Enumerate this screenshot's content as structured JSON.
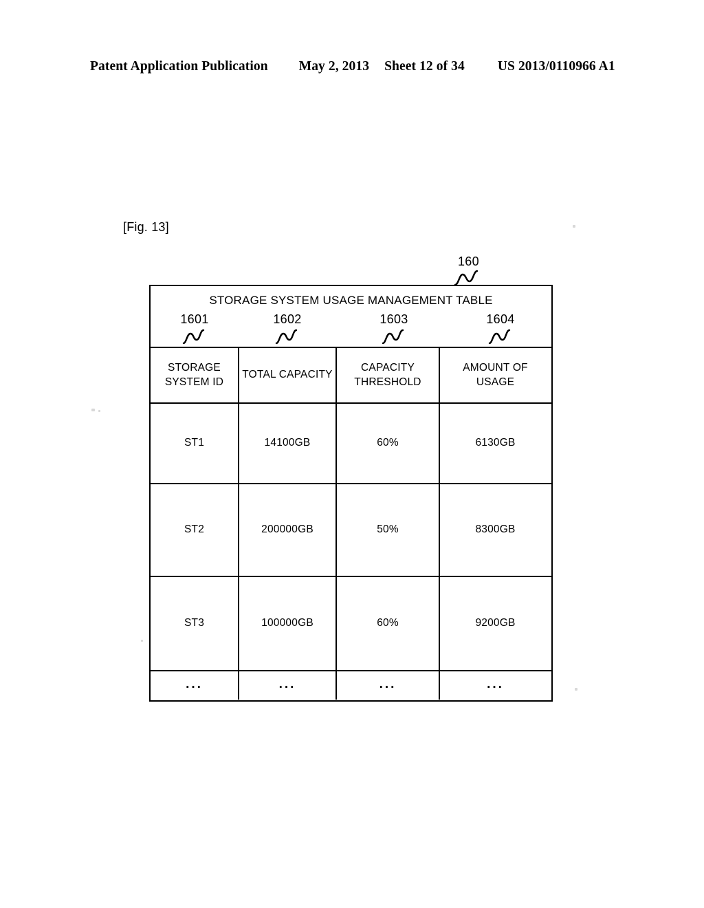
{
  "header": {
    "publication": "Patent Application Publication",
    "date": "May 2, 2013",
    "sheet": "Sheet 12 of 34",
    "patent_number": "US 2013/0110966 A1"
  },
  "figure": {
    "label": "[Fig. 13]",
    "table_reference": "160",
    "title": "STORAGE SYSTEM USAGE MANAGEMENT TABLE",
    "column_references": [
      "1601",
      "1602",
      "1603",
      "1604"
    ],
    "columns": [
      "STORAGE\nSYSTEM ID",
      "TOTAL CAPACITY",
      "CAPACITY\nTHRESHOLD",
      "AMOUNT OF USAGE"
    ],
    "rows": [
      [
        "ST1",
        "14100GB",
        "60%",
        "6130GB"
      ],
      [
        "ST2",
        "200000GB",
        "50%",
        "8300GB"
      ],
      [
        "ST3",
        "100000GB",
        "60%",
        "9200GB"
      ],
      [
        "...",
        "...",
        "...",
        "..."
      ]
    ]
  },
  "colors": {
    "ink": "#000000",
    "paper": "#ffffff"
  }
}
